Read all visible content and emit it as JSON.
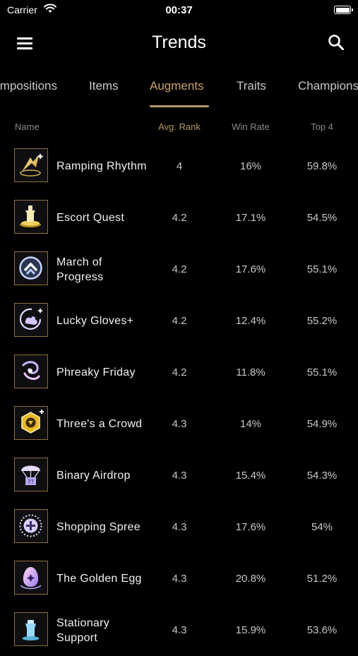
{
  "status": {
    "carrier": "Carrier",
    "time": "00:37"
  },
  "nav": {
    "title": "Trends"
  },
  "tabs": [
    {
      "label": "Compositions"
    },
    {
      "label": "Items"
    },
    {
      "label": "Augments"
    },
    {
      "label": "Traits"
    },
    {
      "label": "Champions"
    }
  ],
  "active_tab": "Augments",
  "columns": {
    "name": "Name",
    "avg_rank": "Avg. Rank",
    "win_rate": "Win Rate",
    "top4": "Top 4"
  },
  "colors": {
    "accent": "#c9a36a",
    "underline": "#b59866",
    "icon_border": "#8c6f3c",
    "background": "#000000"
  },
  "augments": [
    {
      "name": "Ramping Rhythm",
      "avg_rank": "4",
      "win_rate": "16%",
      "top4": "59.8%",
      "icon": "ramping-rhythm-icon"
    },
    {
      "name": "Escort Quest",
      "avg_rank": "4.2",
      "win_rate": "17.1%",
      "top4": "54.5%",
      "icon": "escort-quest-icon"
    },
    {
      "name": "March of Progress",
      "avg_rank": "4.2",
      "win_rate": "17.6%",
      "top4": "55.1%",
      "icon": "march-of-progress-icon"
    },
    {
      "name": "Lucky Gloves+",
      "avg_rank": "4.2",
      "win_rate": "12.4%",
      "top4": "55.2%",
      "icon": "lucky-gloves-icon"
    },
    {
      "name": "Phreaky Friday",
      "avg_rank": "4.2",
      "win_rate": "11.8%",
      "top4": "55.1%",
      "icon": "phreaky-friday-icon"
    },
    {
      "name": "Three's a Crowd",
      "avg_rank": "4.3",
      "win_rate": "14%",
      "top4": "54.9%",
      "icon": "threes-a-crowd-icon"
    },
    {
      "name": "Binary Airdrop",
      "avg_rank": "4.3",
      "win_rate": "15.4%",
      "top4": "54.3%",
      "icon": "binary-airdrop-icon"
    },
    {
      "name": "Shopping Spree",
      "avg_rank": "4.3",
      "win_rate": "17.6%",
      "top4": "54%",
      "icon": "shopping-spree-icon"
    },
    {
      "name": "The Golden Egg",
      "avg_rank": "4.3",
      "win_rate": "20.8%",
      "top4": "51.2%",
      "icon": "golden-egg-icon"
    },
    {
      "name": "Stationary Support",
      "avg_rank": "4.3",
      "win_rate": "15.9%",
      "top4": "53.6%",
      "icon": "stationary-support-icon"
    }
  ]
}
